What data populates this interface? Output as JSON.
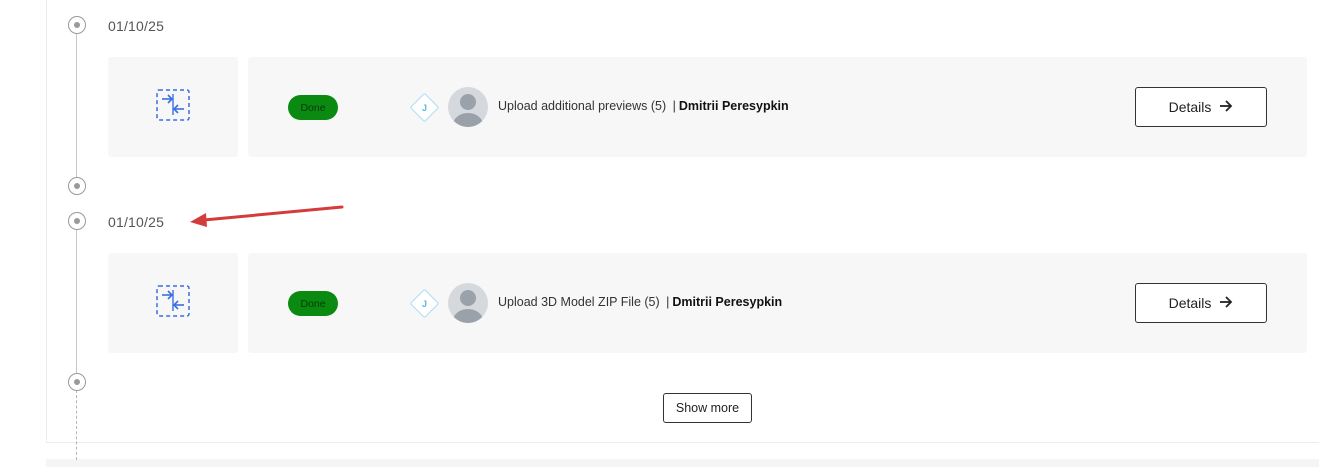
{
  "timeline": {
    "entries": [
      {
        "date": "01/10/25",
        "icon": "merge-arrows-icon",
        "status": "Done",
        "assignee_initial": "J",
        "description": "Upload additional previews (5)",
        "separator": "|",
        "user": "Dmitrii Peresypkin",
        "details_label": "Details"
      },
      {
        "date": "01/10/25",
        "icon": "merge-arrows-icon",
        "status": "Done",
        "assignee_initial": "J",
        "description": "Upload 3D Model ZIP File (5)",
        "separator": "|",
        "user": "Dmitrii Peresypkin",
        "details_label": "Details"
      }
    ],
    "show_more_label": "Show more"
  },
  "colors": {
    "status_done": "#0b8a12",
    "icon_accent": "#3b6fe0",
    "annotation_arrow": "#d43c3c"
  }
}
